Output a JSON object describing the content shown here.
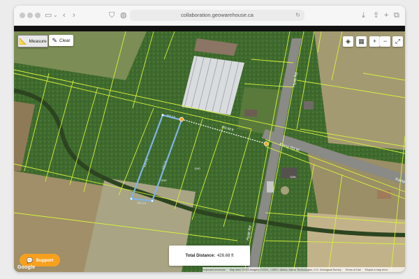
{
  "browser": {
    "url": "collaboration.geowarehouse.ca"
  },
  "tools": {
    "measure_label": "Measure",
    "clear_label": "Clear"
  },
  "map_controls": {
    "layers_icon": "layers-icon",
    "map_type_icon": "map-icon",
    "zoom_in": "+",
    "zoom_out": "−",
    "fullscreen_icon": "fullscreen-icon"
  },
  "roads": {
    "hyatt_rd_upper": "Hyatt Rd",
    "hyatt_rd_lower": "Hyatt Rd",
    "kamp_rd_w": "Kamp Rd W",
    "kamp_rd_e": "Kamp Rd"
  },
  "measurements": {
    "segment_main": "426.68 ft",
    "segment_a": "154.2 ft",
    "segment_b": "426.0 ft",
    "segment_c": "426.0 ft",
    "segment_d": "154.5 ft"
  },
  "parcels": {
    "label_1": "1290",
    "label_2": "1290",
    "label_3": "1256"
  },
  "total": {
    "label": "Total Distance:",
    "value": "426.68 ft"
  },
  "support": {
    "label": "Support"
  },
  "logo": "Google",
  "attribution": {
    "shortcuts": "Keyboard shortcuts",
    "data": "Map data ©2023 Imagery ©2023 , CNES / Airbus, Maxar Technologies, U.S. Geological Survey",
    "terms": "Terms of Use",
    "report": "Report a map error"
  },
  "colors": {
    "parcel_line": "#d7f23a",
    "measure_line": "#7fb3e6",
    "measure_dot": "#f7a01e",
    "support_bg": "#f7a01e"
  }
}
